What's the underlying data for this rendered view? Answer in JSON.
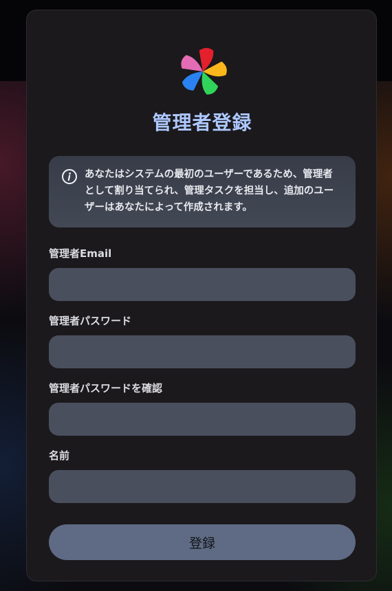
{
  "app": {
    "logo": "immich-pinwheel-logo",
    "title": "管理者登録"
  },
  "info": {
    "icon": "info-circle-icon",
    "message": "あなたはシステムの最初のユーザーであるため、管理者として割り当てられ、管理タスクを担当し、追加のユーザーはあなたによって作成されます。"
  },
  "form": {
    "email_label": "管理者Email",
    "email_value": "",
    "password_label": "管理者パスワード",
    "password_value": "",
    "confirm_label": "管理者パスワードを確認",
    "confirm_value": "",
    "name_label": "名前",
    "name_value": "",
    "submit_label": "登録"
  },
  "colors": {
    "title": "#adc8ff",
    "card": "#1b191c",
    "field": "#4a4f5e",
    "button": "#5f6b85"
  }
}
